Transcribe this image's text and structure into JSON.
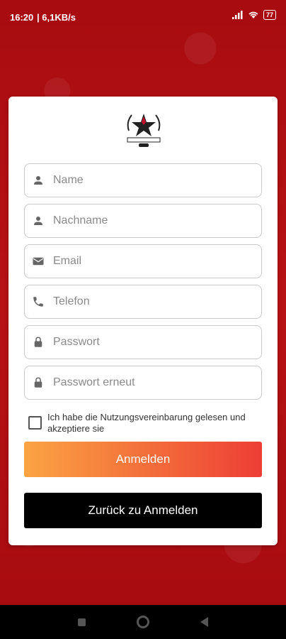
{
  "status_bar": {
    "time": "16:20",
    "network": "| 6,1KB/s",
    "battery": "77"
  },
  "form": {
    "fields": [
      {
        "icon": "person-icon",
        "placeholder": "Name"
      },
      {
        "icon": "person-icon",
        "placeholder": "Nachname"
      },
      {
        "icon": "mail-icon",
        "placeholder": "Email"
      },
      {
        "icon": "phone-icon",
        "placeholder": "Telefon"
      },
      {
        "icon": "lock-icon",
        "placeholder": "Passwort"
      },
      {
        "icon": "lock-icon",
        "placeholder": "Passwort erneut"
      }
    ],
    "agreement": "Ich habe die Nutzungsvereinbarung gelesen und akzeptiere sie",
    "register_label": "Anmelden",
    "back_label": "Zurück zu Anmelden"
  },
  "colors": {
    "background": "#b50f12",
    "primary_start": "#fba443",
    "primary_end": "#ee3e36",
    "secondary": "#000000"
  }
}
